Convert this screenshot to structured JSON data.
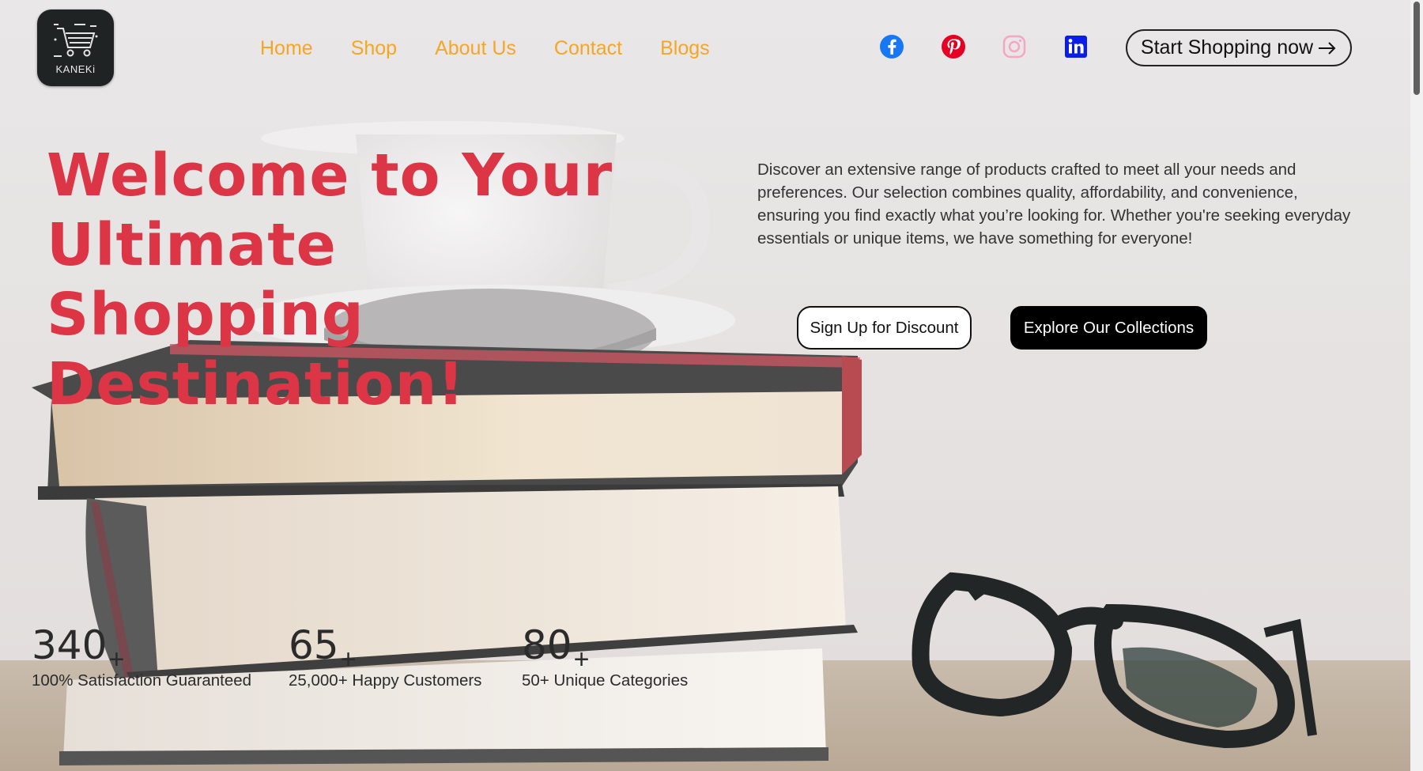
{
  "brand": {
    "logo_text": "KANEKi"
  },
  "nav": {
    "items": [
      {
        "label": "Home"
      },
      {
        "label": "Shop"
      },
      {
        "label": "About Us"
      },
      {
        "label": "Contact"
      },
      {
        "label": "Blogs"
      }
    ]
  },
  "social": {
    "icons": [
      "facebook-icon",
      "pinterest-icon",
      "instagram-icon",
      "linkedin-icon"
    ]
  },
  "header": {
    "cta_label": "Start Shopping now",
    "cta_icon": "arrow-right-icon"
  },
  "hero": {
    "headline": "Welcome to Your Ultimate Shopping Destination!",
    "description": "Discover an extensive range of products crafted to meet all your needs and preferences. Our selection combines quality, affordability, and convenience, ensuring you find exactly what you’re looking for. Whether you're seeking everyday essentials or unique items, we have something for everyone!",
    "primary_button": "Sign Up for Discount",
    "secondary_button": "Explore Our Collections"
  },
  "stats": [
    {
      "number": "340",
      "suffix": "+",
      "label": "100% Satisfaction Guaranteed"
    },
    {
      "number": "65",
      "suffix": "+",
      "label": "25,000+ Happy Customers"
    },
    {
      "number": "80",
      "suffix": "+",
      "label": "50+ Unique Categories"
    }
  ],
  "colors": {
    "accent_nav": "#f5a623",
    "headline": "#dc3545",
    "facebook": "#1877f2",
    "pinterest": "#e60023",
    "instagram": "#f4a6c2",
    "linkedin": "#0a1ee8"
  }
}
